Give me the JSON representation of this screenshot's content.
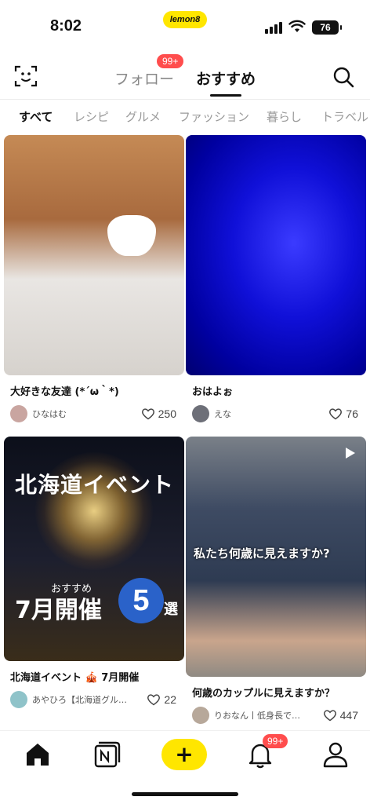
{
  "status": {
    "time": "8:02",
    "battery": "76",
    "logo": "lemon8"
  },
  "header": {
    "tab_follow": "フォロー",
    "tab_recommend": "おすすめ",
    "follow_badge": "99+"
  },
  "categories": [
    "すべて",
    "レシピ",
    "グルメ",
    "ファッション",
    "暮らし",
    "トラベル"
  ],
  "posts": [
    {
      "title": "大好きな友達 (*´ω｀*)",
      "user": "ひなはむ",
      "likes": "250"
    },
    {
      "title": "おはよぉ",
      "user": "えな",
      "likes": "76"
    },
    {
      "title": "北海道イベント 🎪 7月開催",
      "user": "あやひろ【北海道グル…",
      "likes": "22",
      "overlay": {
        "title": "北海道イベント",
        "osusume": "おすすめ",
        "month": "7月開催",
        "count": "5",
        "suffix": "選"
      }
    },
    {
      "title": "何歳のカップルに見えますか？",
      "user": "りおなん丨低身長で…",
      "likes": "447",
      "overlay": {
        "caption": "私たち何歳に見えますか?"
      }
    }
  ],
  "bottom_nav": {
    "create": "+",
    "notification_badge": "99+"
  },
  "colors": {
    "accent": "#ffe600",
    "badge": "#ff4d4d"
  }
}
